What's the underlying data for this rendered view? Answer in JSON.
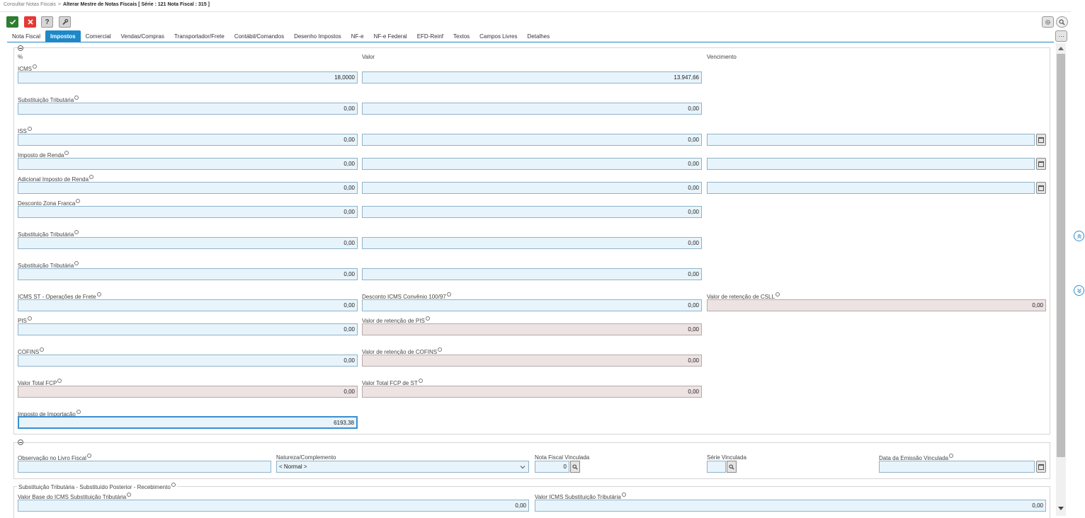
{
  "breadcrumb": {
    "parent": "Consultar Notas Fiscais",
    "separator": ">",
    "current": "Alterar Mestre de Notas Fiscais [ Série : 121 Nota Fiscal : 315 ]"
  },
  "toolbar": {
    "help_label": "?"
  },
  "tabs": [
    "Nota Fiscal",
    "Impostos",
    "Comercial",
    "Vendas/Compras",
    "Transportador/Frete",
    "Contábil/Comandos",
    "Desenho Impostos",
    "NF-e",
    "NF-e Federal",
    "EFD-Reinf",
    "Textos",
    "Campos Livres",
    "Detalhes"
  ],
  "more_label": "···",
  "columns": {
    "percent": "%",
    "value": "Valor",
    "due": "Vencimento"
  },
  "taxes": {
    "icms": {
      "label": "ICMS",
      "percent": "18,0000",
      "value": "13.947,66"
    },
    "st1": {
      "label": "Substituição Tributária",
      "percent": "0,00",
      "value": "0,00"
    },
    "iss": {
      "label": "ISS",
      "percent": "0,00",
      "value": "0,00",
      "due": ""
    },
    "ir": {
      "label": "Imposto de Renda",
      "percent": "0,00",
      "value": "0,00",
      "due": ""
    },
    "air": {
      "label": "Adicional Imposto de Renda",
      "percent": "0,00",
      "value": "0,00",
      "due": ""
    },
    "dzf": {
      "label": "Desconto Zona Franca",
      "percent": "0,00",
      "value": "0,00"
    },
    "st2": {
      "label": "Substituição Tributária",
      "percent": "0,00",
      "value": "0,00"
    },
    "st3": {
      "label": "Substituição Tributária",
      "percent": "0,00",
      "value": "0,00"
    },
    "icms_st_frete": {
      "label": "ICMS ST - Operações de Frete",
      "value": "0,00"
    },
    "desc_icms_conv": {
      "label": "Desconto ICMS Convênio 100/97",
      "value": "0,00"
    },
    "ret_csll": {
      "label": "Valor de retenção de CSLL",
      "value": "0,00"
    },
    "pis": {
      "label": "PIS",
      "value": "0,00"
    },
    "ret_pis": {
      "label": "Valor de retenção de PIS",
      "value": "0,00"
    },
    "cofins": {
      "label": "COFINS",
      "value": "0,00"
    },
    "ret_cofins": {
      "label": "Valor de retenção de COFINS",
      "value": "0,00"
    },
    "fcp": {
      "label": "Valor Total FCP",
      "value": "0,00"
    },
    "fcp_st": {
      "label": "Valor Total FCP de ST",
      "value": "0,00"
    },
    "importacao": {
      "label": "Imposto de Importação",
      "value": "6193,38"
    }
  },
  "section2": {
    "obs": {
      "label": "Observação no Livro Fiscal",
      "value": ""
    },
    "natureza": {
      "label": "Natureza/Complemento",
      "value": "< Normal >"
    },
    "nf_vinc": {
      "label": "Nota Fiscal Vinculada",
      "value": "0"
    },
    "serie_vinc": {
      "label": "Série Vinculada",
      "value": ""
    },
    "data_vinc": {
      "label": "Data da Emissão Vinculada",
      "value": ""
    }
  },
  "section3": {
    "title": "Substituição Tributária - Substituído Posterior - Recebimento",
    "base": {
      "label": "Valor Base do ICMS Substituição Tributária",
      "value": "0,00"
    },
    "icms_st": {
      "label": "Valor ICMS Substituição Tributária",
      "value": "0,00"
    }
  }
}
